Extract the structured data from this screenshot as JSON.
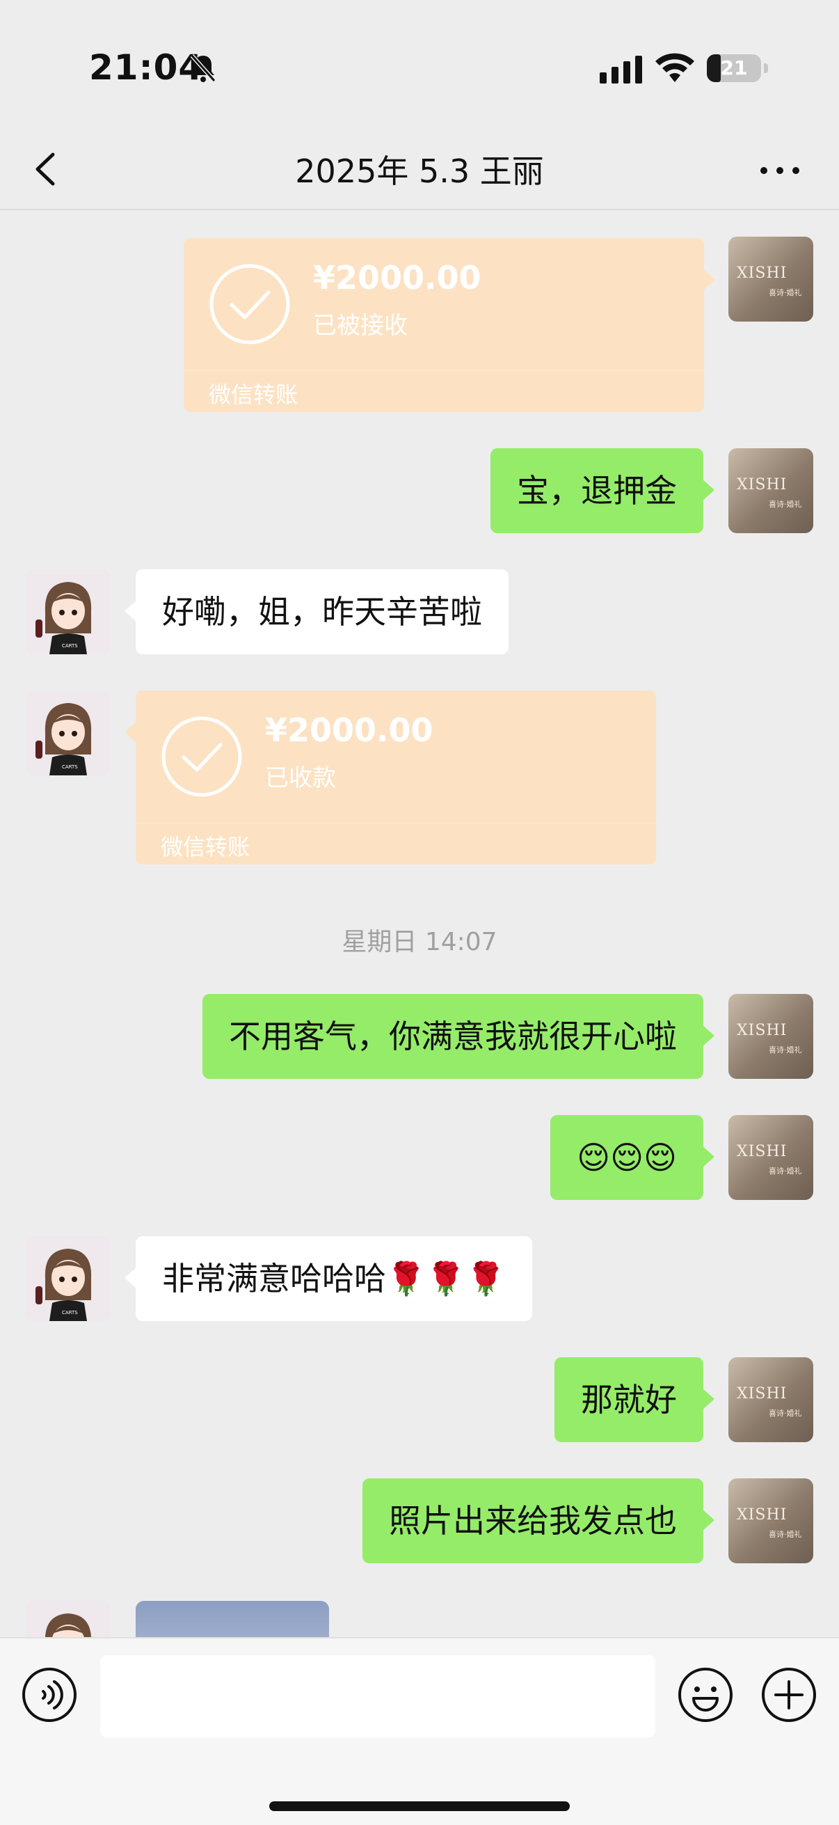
{
  "status_bar": {
    "time": "21:04",
    "battery": "21",
    "icons": [
      "bell-slash-icon",
      "cellular-signal-icon",
      "wifi-icon",
      "battery-icon"
    ]
  },
  "header": {
    "title": "2025年 5.3 王丽",
    "back_icon": "chevron-left-icon",
    "more_icon": "more-dots-icon"
  },
  "messages": [
    {
      "type": "transfer",
      "sender": "self",
      "amount": "¥2000.00",
      "status": "已被接收",
      "source": "微信转账"
    },
    {
      "type": "text",
      "sender": "self",
      "text": "宝，退押金"
    },
    {
      "type": "text",
      "sender": "other",
      "text": "好嘞，姐，昨天辛苦啦"
    },
    {
      "type": "transfer",
      "sender": "other",
      "amount": "¥2000.00",
      "status": "已收款",
      "source": "微信转账"
    },
    {
      "type": "time",
      "text": "星期日 14:07"
    },
    {
      "type": "text",
      "sender": "self",
      "text": "不用客气，你满意我就很开心啦"
    },
    {
      "type": "text",
      "sender": "self",
      "text": "😌😌😌"
    },
    {
      "type": "text",
      "sender": "other",
      "text": "非常满意哈哈哈🌹🌹🌹"
    },
    {
      "type": "text",
      "sender": "self",
      "text": "那就好"
    },
    {
      "type": "text",
      "sender": "self",
      "text": "照片出来给我发点也"
    },
    {
      "type": "image",
      "sender": "other"
    }
  ],
  "self_avatar": {
    "logo": "XISHI",
    "logo_sub": "喜诗·婚礼"
  },
  "other_avatar": {
    "shirt_text": "CARTS"
  },
  "input_bar": {
    "message_value": "",
    "icons": [
      "voice-icon",
      "emoji-icon",
      "plus-icon"
    ]
  },
  "colors": {
    "background": "#ededed",
    "self_bubble": "#95ec69",
    "other_bubble": "#ffffff",
    "transfer_card": "#fce2c3",
    "timestamp_text": "#a0a0a0"
  }
}
